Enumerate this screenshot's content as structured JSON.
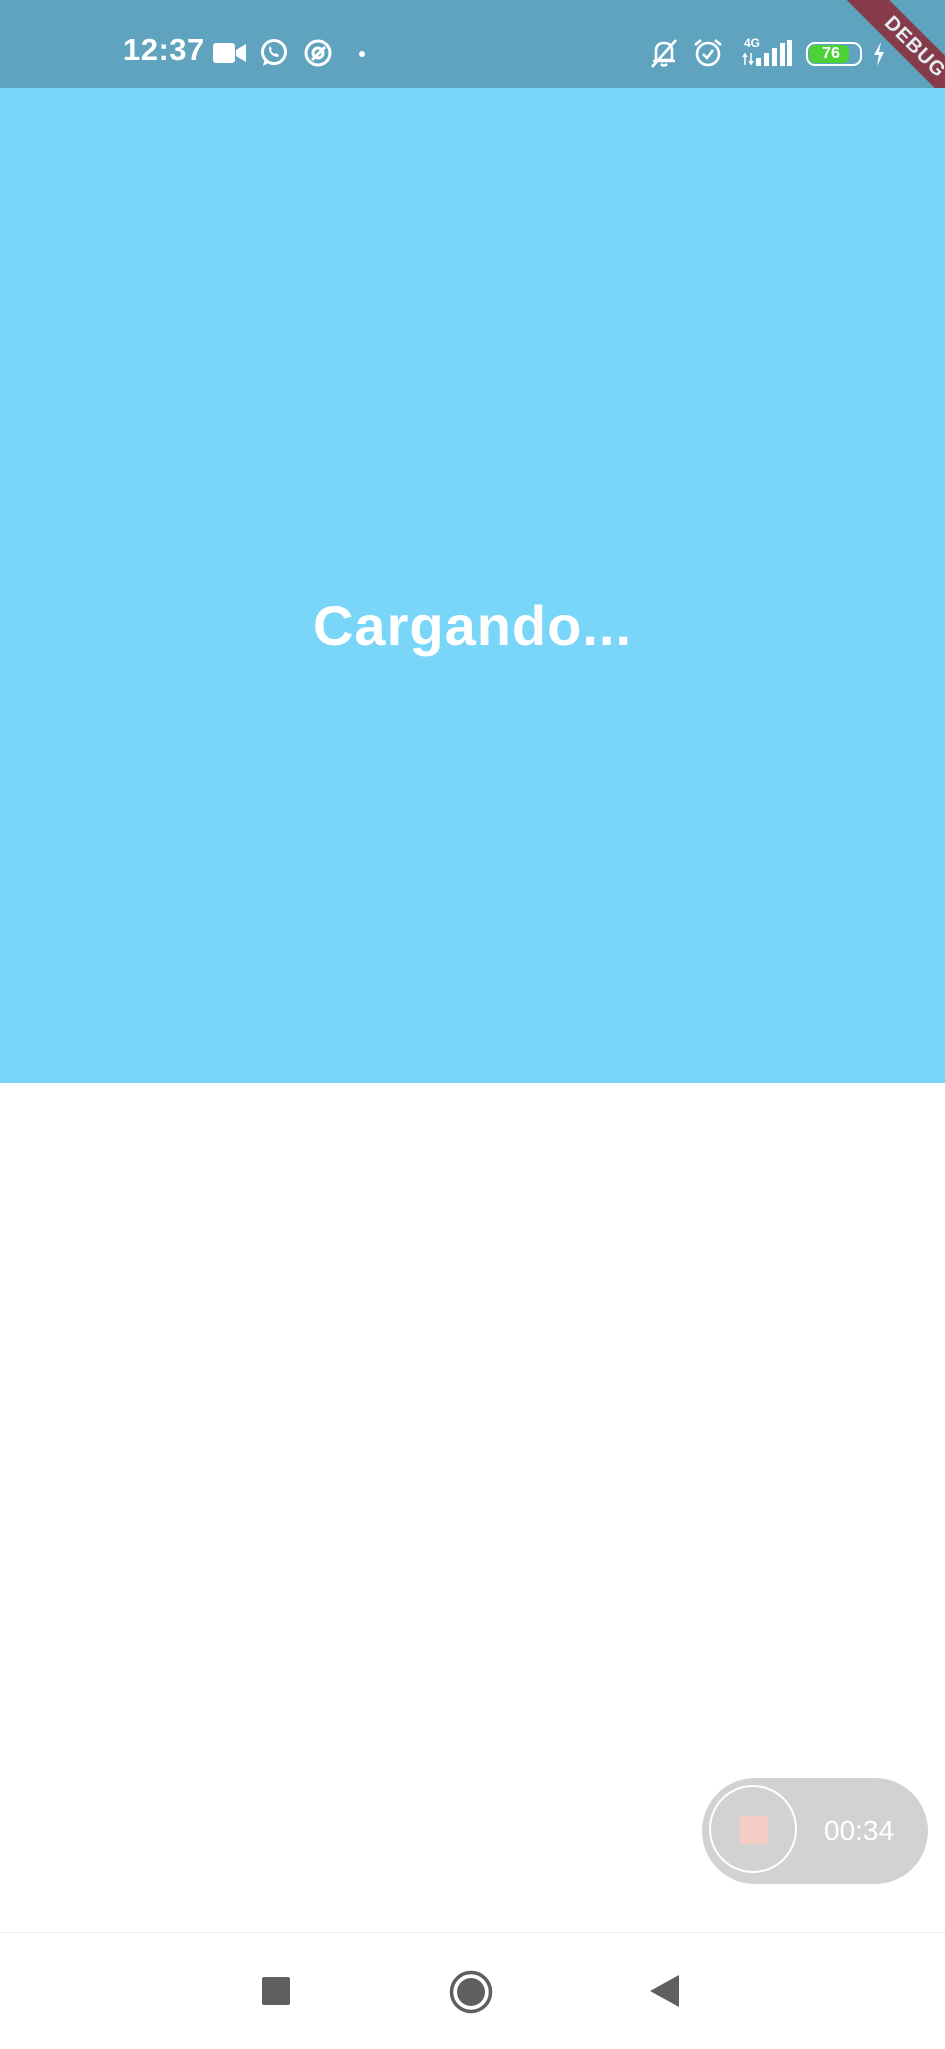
{
  "status_bar": {
    "time": "12:37",
    "left_icons": [
      "video-camera-icon",
      "whatsapp-icon",
      "at-sign-icon",
      "dot-icon"
    ],
    "right_icons": [
      "bell-off-icon",
      "alarm-clock-icon",
      "network-4g-icon",
      "signal-bars-icon",
      "battery-icon",
      "charging-bolt-icon"
    ],
    "network_label": "4G",
    "battery_level": "76",
    "battery_color": "#4cd137"
  },
  "debug_banner": {
    "label": "DEBUG",
    "color": "#8e2530"
  },
  "main": {
    "loading_text": "Cargando...",
    "banner_color": "#7ad6f9"
  },
  "recorder": {
    "time": "00:34",
    "icon": "stop-icon"
  },
  "nav_bar": {
    "buttons": [
      "recents-square-icon",
      "home-circle-icon",
      "back-triangle-icon"
    ]
  }
}
